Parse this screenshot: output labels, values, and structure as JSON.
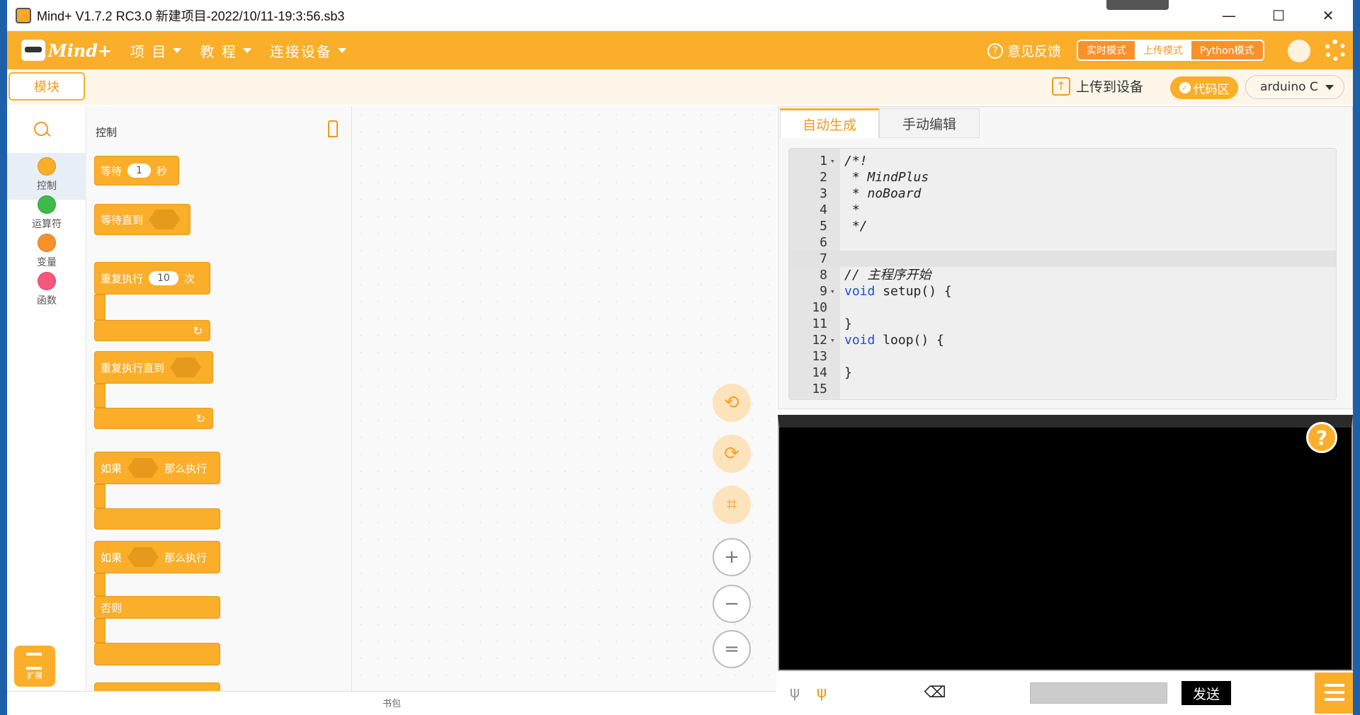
{
  "window": {
    "title": "Mind+ V1.7.2 RC3.0   新建项目-2022/10/11-19:3:56.sb3",
    "min": "—",
    "max": "☐",
    "close": "✕"
  },
  "menu": {
    "logo": "Mind+",
    "items": [
      "项 目",
      "教 程",
      "连接设备"
    ]
  },
  "header": {
    "feedback": "意见反馈",
    "modes": [
      "实时模式",
      "上传模式",
      "Python模式"
    ],
    "active_mode": "上传模式"
  },
  "toolbar": {
    "blocks_tab": "模块",
    "upload": "上传到设备",
    "code_area": "代码区",
    "board": "arduino C"
  },
  "categories": [
    {
      "label": "控制",
      "color": "#fbae2a"
    },
    {
      "label": "运算符",
      "color": "#3dbb4a"
    },
    {
      "label": "变量",
      "color": "#f7922b"
    },
    {
      "label": "函数",
      "color": "#f7577b"
    }
  ],
  "extension": "扩展",
  "palette": {
    "title": "控制",
    "blocks": {
      "wait": "等待",
      "wait_value": "1",
      "wait_unit": "秒",
      "wait_until": "等待直到",
      "repeat": "重复执行",
      "repeat_value": "10",
      "repeat_unit": "次",
      "repeat_until": "重复执行直到",
      "if": "如果",
      "then": "那么执行",
      "else": "否则"
    }
  },
  "canvas": {
    "bookbag": "书包"
  },
  "code": {
    "tabs": [
      "自动生成",
      "手动编辑"
    ],
    "active_tab": "自动生成",
    "lines": [
      {
        "n": "1",
        "fold": true,
        "text": "/*!",
        "cls": "cm"
      },
      {
        "n": "2",
        "text": " * MindPlus",
        "cls": "cm"
      },
      {
        "n": "3",
        "text": " * noBoard",
        "cls": "cm"
      },
      {
        "n": "4",
        "text": " *",
        "cls": "cm"
      },
      {
        "n": "5",
        "text": " */",
        "cls": "cm"
      },
      {
        "n": "6",
        "text": ""
      },
      {
        "n": "7",
        "text": "",
        "cur": true
      },
      {
        "n": "8",
        "text": "// 主程序开始",
        "cls": "cm"
      },
      {
        "n": "9",
        "fold": true,
        "kw": "void",
        "text": " setup() {"
      },
      {
        "n": "10",
        "text": ""
      },
      {
        "n": "11",
        "text": "}"
      },
      {
        "n": "12",
        "fold": true,
        "kw": "void",
        "text": " loop() {"
      },
      {
        "n": "13",
        "text": ""
      },
      {
        "n": "14",
        "text": "}"
      },
      {
        "n": "15",
        "text": ""
      }
    ]
  },
  "serial": {
    "help": "?",
    "send": "发送"
  }
}
